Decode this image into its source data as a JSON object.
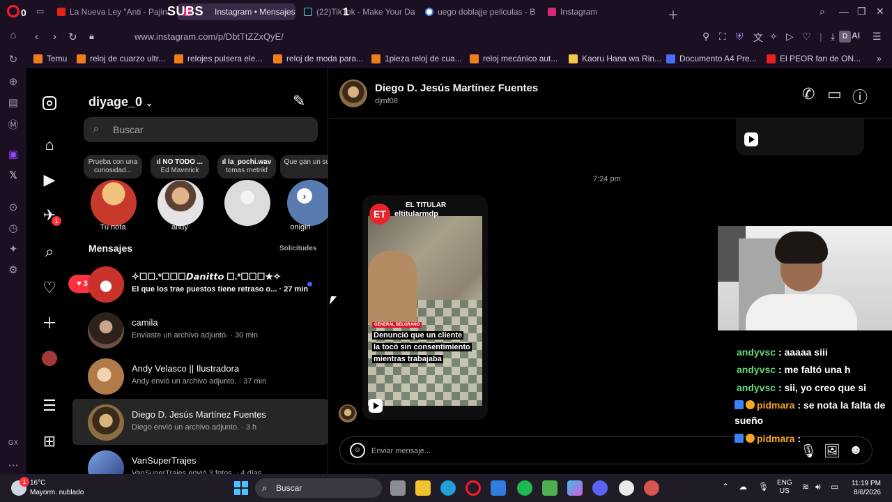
{
  "browser": {
    "tabs": [
      {
        "label": "La Nueva Ley \"Anti - Pajina",
        "favicon_color": "#e6211e"
      },
      {
        "label": "Instagram • Mensajes",
        "favicon_color": "#d6297a",
        "active": true
      },
      {
        "label": "(22)TikTok - Make Your Da",
        "favicon_color": "#000000"
      },
      {
        "label": "uego doblajje peliculas - B",
        "favicon_color": "#4285f4"
      },
      {
        "label": "Instagram",
        "favicon_color": "#d6297a"
      }
    ],
    "stream_overlay_subs": "SUBS",
    "overlay_count_left": "0",
    "overlay_count_mid": "1",
    "url": "www.instagram.com/p/DbtTtZZxQyE/",
    "ai_label": "AI",
    "profile_letter": "D",
    "bookmarks": [
      {
        "label": "Temu",
        "color": "#f07c1c"
      },
      {
        "label": "reloj de cuarzo ultr...",
        "color": "#f07c1c"
      },
      {
        "label": "relojes pulsera ele...",
        "color": "#f07c1c"
      },
      {
        "label": "reloj de moda para...",
        "color": "#f07c1c"
      },
      {
        "label": "1pieza reloj de cua...",
        "color": "#f07c1c"
      },
      {
        "label": "reloj mecánico aut...",
        "color": "#f07c1c"
      },
      {
        "label": "Kaoru Hana wa Rin...",
        "color": "#f2c94c"
      },
      {
        "label": "Documento A4 Pre...",
        "color": "#4a6cf7"
      },
      {
        "label": "El PEOR fan de ON...",
        "color": "#e6211e"
      }
    ]
  },
  "instagram": {
    "nav_badge": "1",
    "account": "diyage_0",
    "search_placeholder": "Buscar",
    "notes": [
      {
        "text": "Prueba con una curiosidad...",
        "name": "Tu nota",
        "avatar": "#c73a2b"
      },
      {
        "text_bold": "NO TODO ...",
        "text": "Ed Maverick",
        "name": "andy",
        "avatar": "#b9b0b8"
      },
      {
        "text_bold": "la_pochi.wav",
        "text": "tomas metrikf",
        "name": "",
        "avatar": "#d9d9d9"
      },
      {
        "text": "Que gan un susl",
        "name": "onigiri",
        "avatar": "#5a7bb0"
      }
    ],
    "messages_heading": "Mensajes",
    "requests_label": "Solicitudes",
    "heart_count": "3",
    "conversations": [
      {
        "name": "✧☐☐.*☐☐☐𝘿𝙖𝙣𝙞𝙩𝙩𝙤 ☐.*☐☐☐★✧",
        "preview": "El que los trae puestos tiene retraso o... · 27 min",
        "unread": true,
        "avatar": "#c9322a"
      },
      {
        "name": "camila",
        "preview": "Enviaste un archivo adjunto. · 30 min",
        "avatar": "#6b4f42"
      },
      {
        "name": "Andy Velasco || Ilustradora",
        "preview": "Andy envió un archivo adjunto. · 37 min",
        "avatar": "#c6995d"
      },
      {
        "name": "Diego D. Jesús Martínez Fuentes",
        "preview": "Diego envió un archivo adjunto. · 3 h",
        "active": true,
        "avatar": "#8b6d43"
      },
      {
        "name": "VanSuperTrajes",
        "preview": "VanSuperTrajes envió 3 fotos. · 4 días",
        "avatar": "#4f6fb5"
      }
    ],
    "chat": {
      "name": "Diego D. Jesús Martínez Fuentes",
      "handle": "djmf08",
      "timestamp": "7:24 pm",
      "reel": {
        "logo": "ET",
        "source": "EL TITULAR",
        "handle": "eltitularmdp",
        "tag": "GENERAL BELGRANO",
        "caption_lines": [
          "Denunció que un cliente",
          "la tocó sin consentimiento",
          "mientras trabajaba"
        ]
      },
      "composer_placeholder": "Enviar mensaje..."
    }
  },
  "stream": {
    "chat": [
      {
        "user": "andyvsc",
        "text": ": aaaaa siii",
        "color": "#67d67b"
      },
      {
        "user": "andyvsc",
        "text": ": me faltó una h",
        "color": "#67d67b"
      },
      {
        "user": "andyvsc",
        "text": ": sii, yo creo que si",
        "color": "#67d67b"
      },
      {
        "user": "pidmara",
        "text": ": se nota la falta de sueño",
        "color": "#f5a623"
      },
      {
        "user": "pidmara",
        "text": ":",
        "color": "#f5a623"
      }
    ]
  },
  "taskbar": {
    "weather_badge": "1",
    "temp": "16°C",
    "condition": "Mayorm. nublado",
    "search_label": "Buscar",
    "lang_1": "ENG",
    "lang_2": "US",
    "time": "11:19 PM",
    "date": "8/6/2026"
  }
}
